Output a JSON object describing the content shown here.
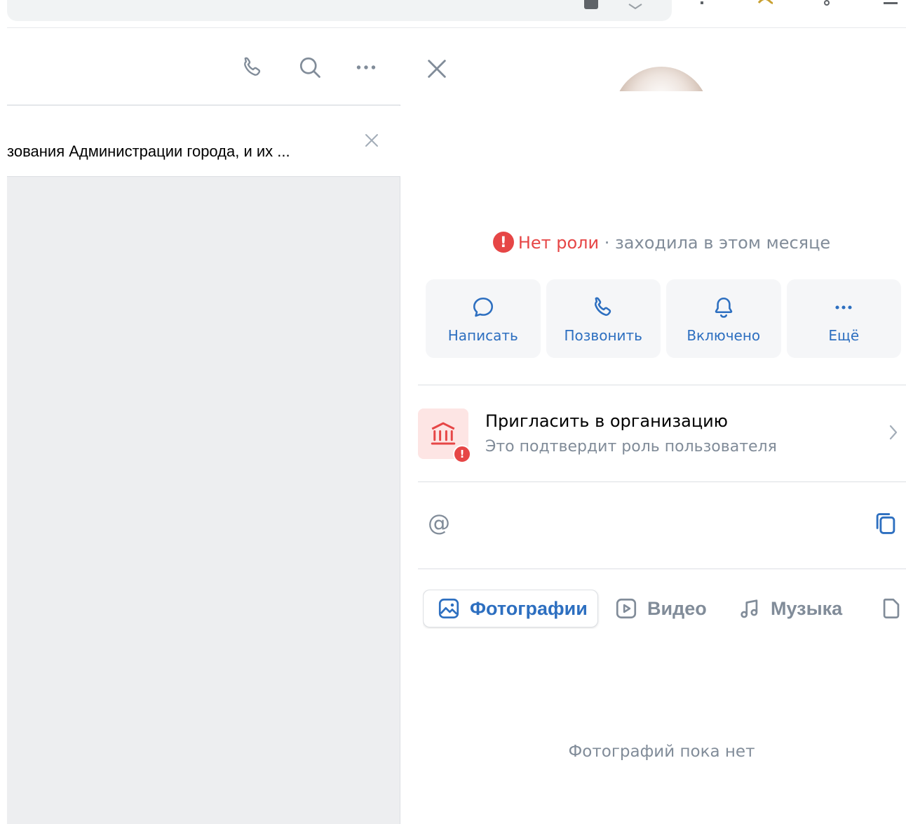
{
  "pinned": {
    "text": "зования Администрации города, и их ..."
  },
  "profile": {
    "status_role": "Нет роли",
    "status_separator": "·",
    "status_last_seen": "заходила в этом месяце",
    "alert_mark": "!"
  },
  "actions": [
    {
      "label": "Написать",
      "icon": "message-icon"
    },
    {
      "label": "Позвонить",
      "icon": "phone-icon"
    },
    {
      "label": "Включено",
      "icon": "bell-icon"
    },
    {
      "label": "Ещё",
      "icon": "more-icon"
    }
  ],
  "invite": {
    "title": "Пригласить в организацию",
    "subtitle": "Это подтвердит роль пользователя",
    "badge": "!"
  },
  "contact": {
    "at_symbol": "@"
  },
  "media_tabs": [
    {
      "label": "Фотографии",
      "icon": "photo-icon",
      "active": true
    },
    {
      "label": "Видео",
      "icon": "video-icon",
      "active": false
    },
    {
      "label": "Музыка",
      "icon": "music-icon",
      "active": false
    },
    {
      "label": "",
      "icon": "file-icon",
      "active": false
    }
  ],
  "empty_state": "Фотографий пока нет",
  "colors": {
    "accent": "#2d6fc0",
    "alert": "#e64646",
    "secondary_text": "#818c99",
    "chat_background": "#edeef0",
    "action_background": "#f5f6f8"
  }
}
